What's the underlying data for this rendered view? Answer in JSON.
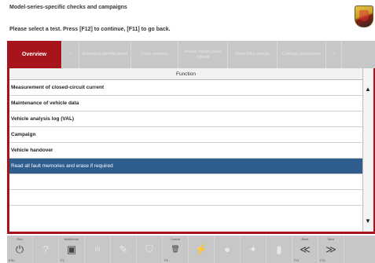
{
  "header": {
    "title": "Model-series-specific checks and campaigns",
    "instruction": "Please select a test. Press [F12] to continue, [F11] to go back."
  },
  "tabs": [
    {
      "label": "Overview",
      "active": true
    },
    {
      "label": "»",
      "active": false
    },
    {
      "label": "Extended identifications",
      "active": false
    },
    {
      "label": "Fault memory",
      "active": false
    },
    {
      "label": "Actual values input signals",
      "active": false
    },
    {
      "label": "Drive links checks",
      "active": false
    },
    {
      "label": "Codings adaptations",
      "active": false
    },
    {
      "label": "»",
      "active": false
    }
  ],
  "table": {
    "column_header": "Function",
    "rows": [
      {
        "label": "Measurement of closed-circuit current",
        "selected": false
      },
      {
        "label": "Maintenance of vehicle data",
        "selected": false
      },
      {
        "label": "Vehicle analysis log (VAL)",
        "selected": false
      },
      {
        "label": "Campaign",
        "selected": false
      },
      {
        "label": "Vehicle handover",
        "selected": false
      },
      {
        "label": "Read all fault memories and erase if required",
        "selected": true
      },
      {
        "label": "",
        "selected": false
      },
      {
        "label": "",
        "selected": false
      }
    ]
  },
  "scroll": {
    "up_icon": "▲",
    "down_icon": "▼"
  },
  "footer": {
    "buttons": [
      {
        "label": "End",
        "key": "ESC",
        "icon": "⏻",
        "dark": true
      },
      {
        "label": "",
        "key": "",
        "icon": "?",
        "dark": false
      },
      {
        "label": "Multimeter",
        "key": "F2",
        "icon": "▣",
        "dark": true
      },
      {
        "label": "",
        "key": "",
        "icon": "ılı",
        "dark": false
      },
      {
        "label": "",
        "key": "",
        "icon": "✎",
        "dark": false
      },
      {
        "label": "",
        "key": "",
        "icon": "⛉",
        "dark": false
      },
      {
        "label": "Cancel",
        "key": "F6",
        "icon": "🗑",
        "dark": true
      },
      {
        "label": "",
        "key": "",
        "icon": "⚡",
        "dark": false
      },
      {
        "label": "",
        "key": "",
        "icon": "●",
        "dark": false
      },
      {
        "label": "",
        "key": "",
        "icon": "✦",
        "dark": false
      },
      {
        "label": "",
        "key": "",
        "icon": "▮",
        "dark": false
      },
      {
        "label": "Back",
        "key": "F11",
        "icon": "≪",
        "dark": true
      },
      {
        "label": "Next",
        "key": "F12",
        "icon": "≫",
        "dark": true
      }
    ]
  },
  "colors": {
    "accent": "#a8141c",
    "selected_row": "#2f5d8e",
    "bar_gray": "#c7c7c7"
  }
}
